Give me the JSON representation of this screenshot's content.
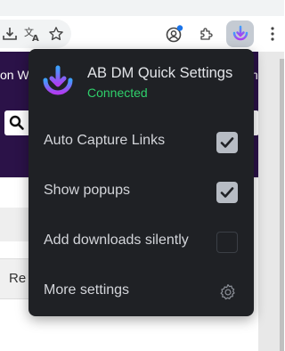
{
  "page": {
    "banner_text_left": "on Wo",
    "banner_text_right": "h",
    "remove_button_label": "Re"
  },
  "toolbar": {
    "icons": [
      "download-icon",
      "translate-icon",
      "star-icon",
      "profile-icon",
      "extensions-puzzle-icon",
      "ab-dm-extension-icon",
      "more-menu-icon"
    ]
  },
  "popup": {
    "title": "AB DM Quick Settings",
    "status": "Connected",
    "status_color": "#2fd06b",
    "options": [
      {
        "label": "Auto Capture Links",
        "checked": true
      },
      {
        "label": "Show popups",
        "checked": true
      },
      {
        "label": "Add downloads silently",
        "checked": false
      }
    ],
    "more_settings_label": "More settings"
  },
  "colors": {
    "popup_bg": "#1f2125",
    "page_banner": "#2b1248",
    "logo_gradient_top": "#3ea0ff",
    "logo_gradient_bottom": "#b03cf0"
  }
}
